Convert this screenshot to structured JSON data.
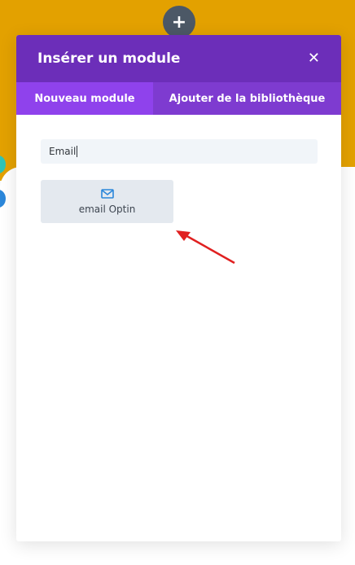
{
  "colors": {
    "bg_top": "#e3a100",
    "header": "#6c2eb9",
    "tabs": "#7e3bd0",
    "tab_active": "#8f42ec",
    "module_icon": "#2b87da",
    "arrow": "#e02020"
  },
  "add_button": {
    "label": "+"
  },
  "modal": {
    "title": "Insérer un module",
    "close_icon": "close-icon",
    "tabs": [
      {
        "label": "Nouveau module",
        "active": true
      },
      {
        "label": "Ajouter de la bibliothèque",
        "active": false
      }
    ],
    "search": {
      "value": "Email"
    },
    "modules": [
      {
        "label": "email Optin",
        "icon": "envelope-icon"
      }
    ]
  }
}
